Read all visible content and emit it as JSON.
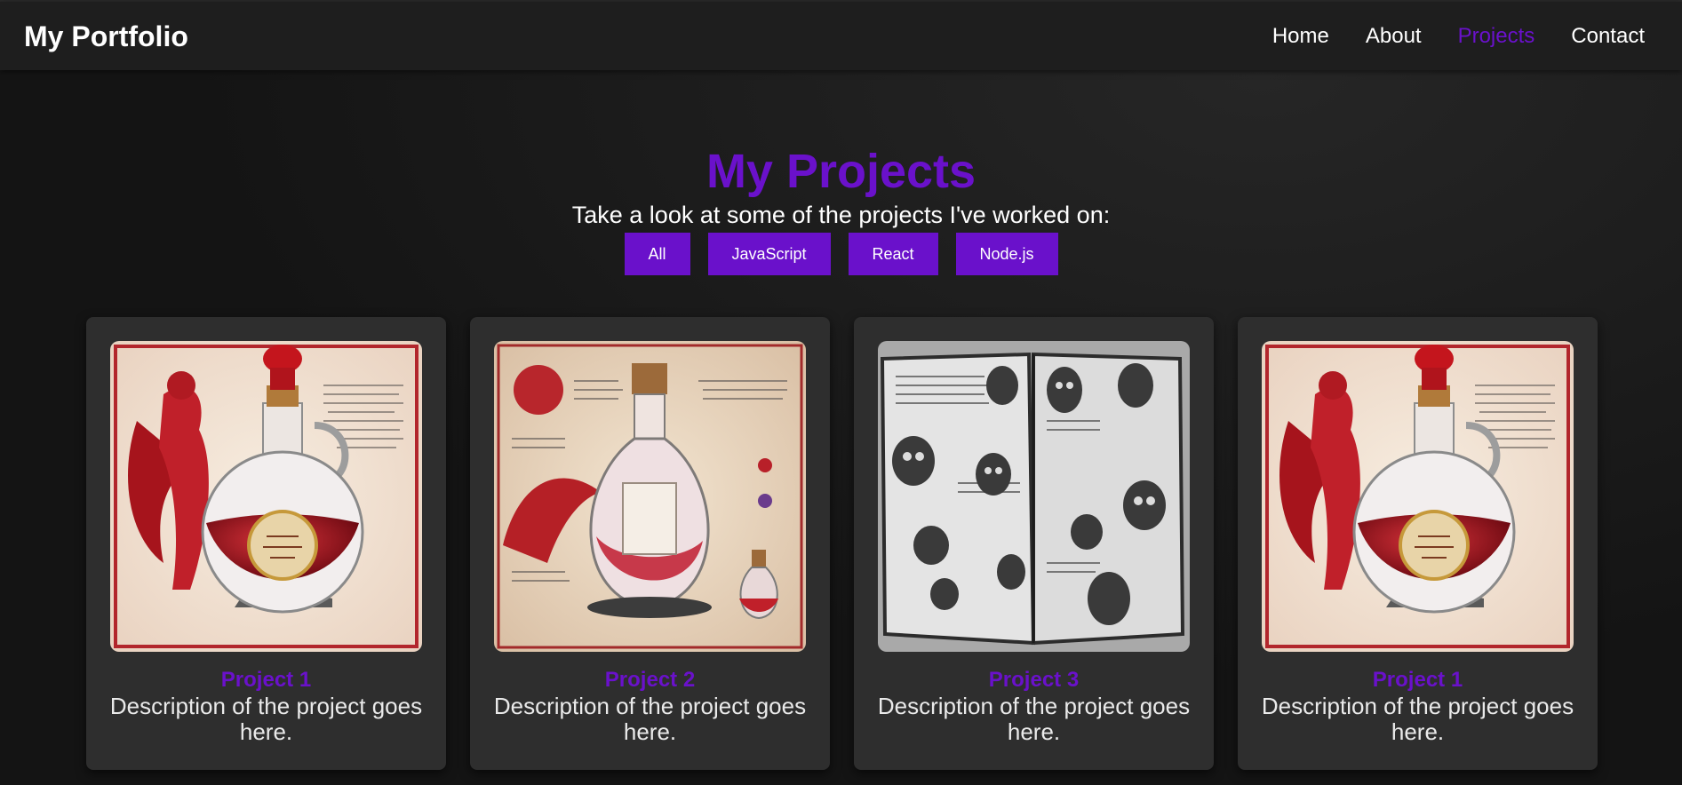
{
  "header": {
    "brand": "My Portfolio",
    "nav": [
      "Home",
      "About",
      "Projects",
      "Contact"
    ],
    "active": "Projects"
  },
  "hero": {
    "title": "My Projects",
    "subtitle": "Take a look at some of the projects I've worked on:"
  },
  "filters": [
    "All",
    "JavaScript",
    "React",
    "Node.js"
  ],
  "projects": [
    {
      "title": "Project 1",
      "description": "Description of the project goes here.",
      "image": "dragon-potion-illustration"
    },
    {
      "title": "Project 2",
      "description": "Description of the project goes here.",
      "image": "potion-creation-illustration"
    },
    {
      "title": "Project 3",
      "description": "Description of the project goes here.",
      "image": "skull-sketchbook-illustration"
    },
    {
      "title": "Project 1",
      "description": "Description of the project goes here.",
      "image": "dragon-potion-illustration"
    }
  ],
  "colors": {
    "accent": "#6a11cb",
    "background": "#141414",
    "card": "#2e2e2e",
    "header": "#1e1e1e"
  }
}
